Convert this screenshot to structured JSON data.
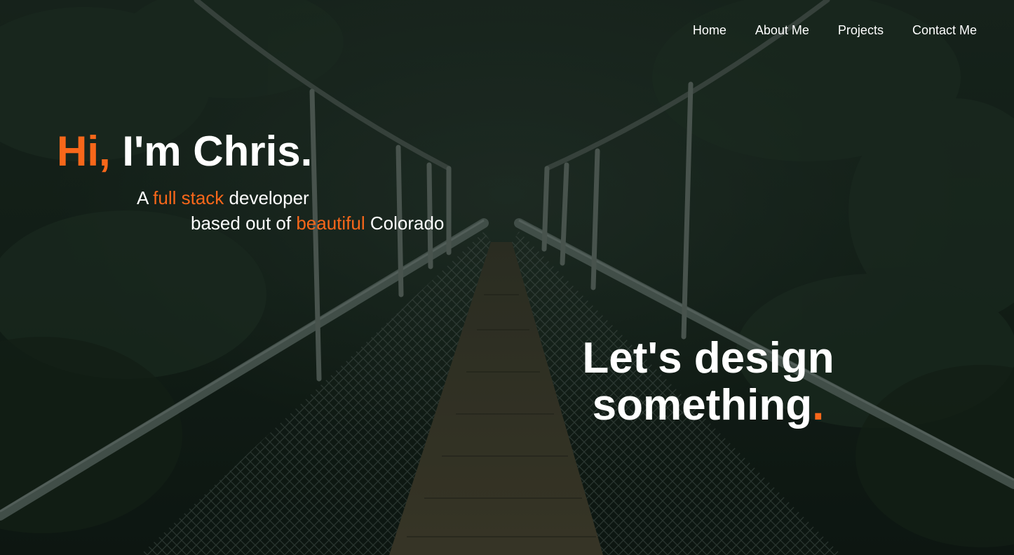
{
  "nav": {
    "items": [
      {
        "label": "Home"
      },
      {
        "label": "About Me"
      },
      {
        "label": "Projects"
      },
      {
        "label": "Contact Me"
      }
    ]
  },
  "hero": {
    "greeting": "Hi,",
    "name": " I'm Chris.",
    "line1": {
      "pre": "A ",
      "accent": "full stack",
      "post": " developer"
    },
    "line2": {
      "pre": "based out of ",
      "accent": "beautiful",
      "post": " Colorado"
    }
  },
  "cta": {
    "line1": "Let's design",
    "line2": "something",
    "dot": "."
  },
  "colors": {
    "accent": "#f8671a",
    "text": "#ffffff",
    "overlay": "#0f1a14"
  }
}
